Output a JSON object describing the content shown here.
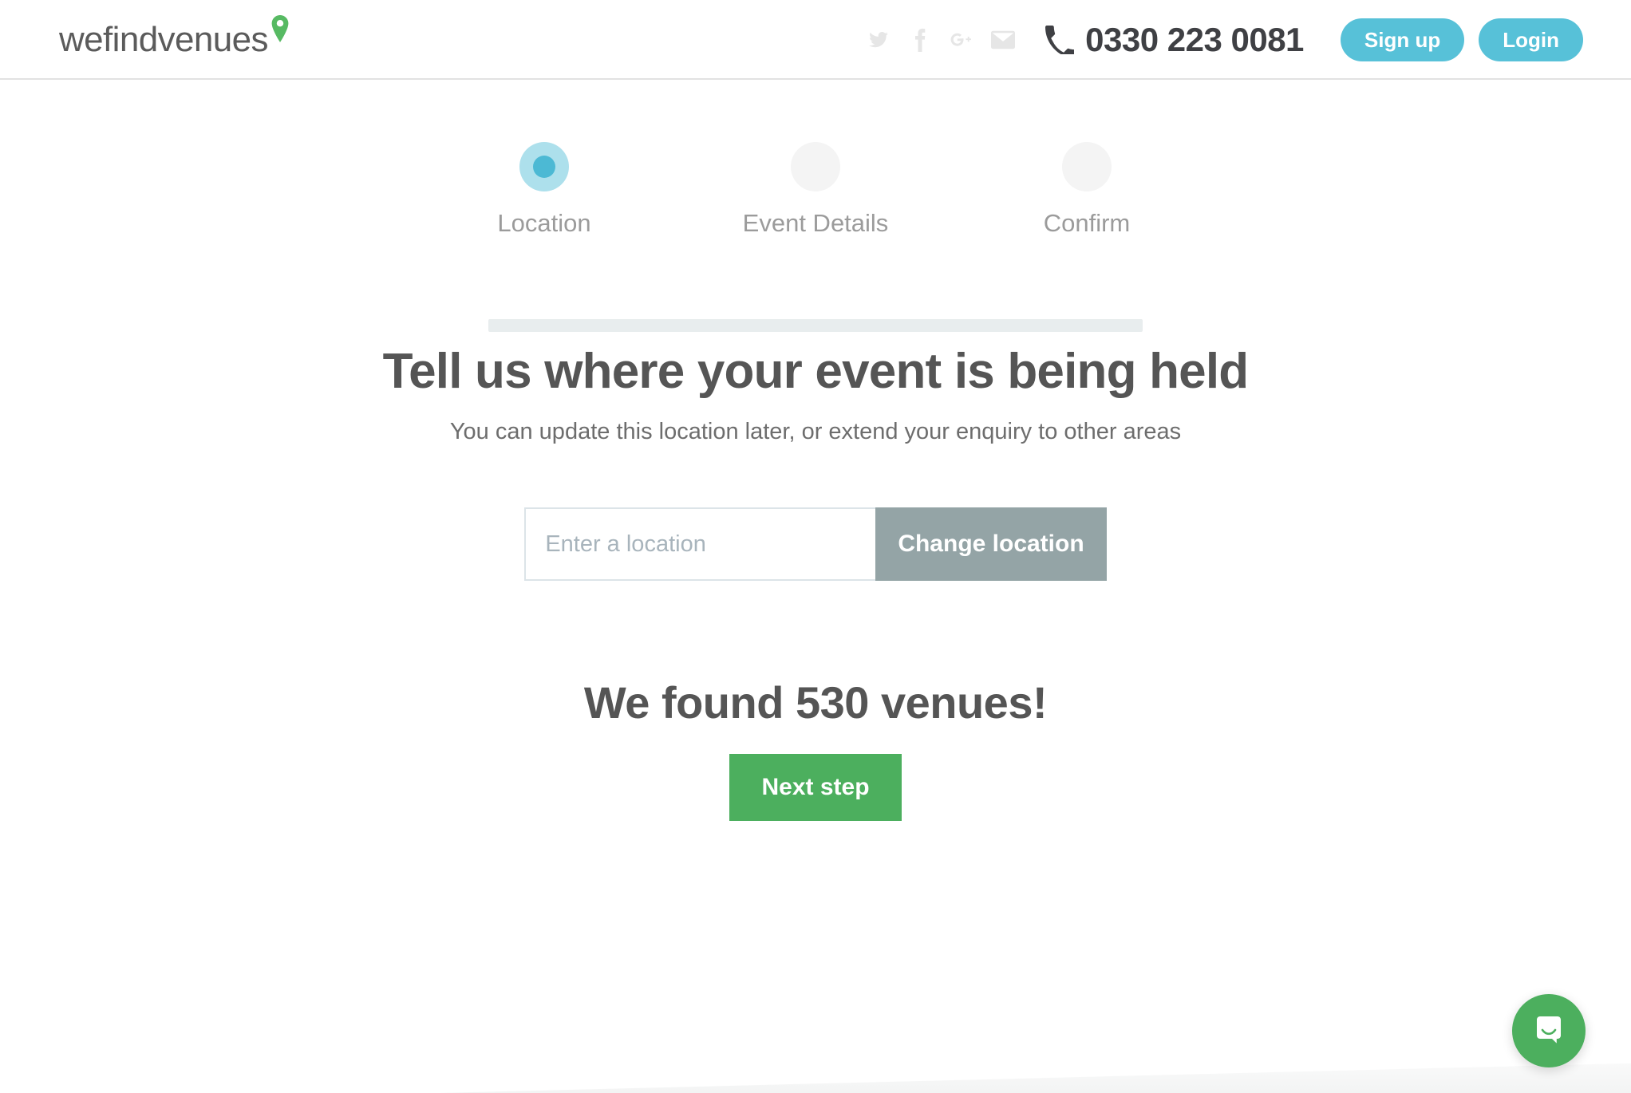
{
  "header": {
    "logo": {
      "text": "wefindvenues",
      "pin_icon": "map-pin-icon",
      "pin_color": "#57ba63"
    },
    "social": [
      {
        "name": "twitter-icon",
        "label": "Twitter"
      },
      {
        "name": "facebook-icon",
        "label": "Facebook"
      },
      {
        "name": "google-plus-icon",
        "label": "Google Plus"
      },
      {
        "name": "email-icon",
        "label": "Email"
      }
    ],
    "phone": {
      "icon": "phone-icon",
      "number": "0330 223 0081"
    },
    "signup_label": "Sign up",
    "login_label": "Login",
    "accent_color": "#57c1d8"
  },
  "stepper": {
    "active_index": 0,
    "steps": [
      {
        "label": "Location"
      },
      {
        "label": "Event Details"
      },
      {
        "label": "Confirm"
      }
    ],
    "active_ring_color": "#ade0ec",
    "active_dot_color": "#4cb9d4",
    "inactive_color": "#f4f4f4",
    "bar_color": "#e8edee"
  },
  "main": {
    "headline": "Tell us where your event is being held",
    "subhead": "You can update this location later, or extend your enquiry to other areas",
    "location_input": {
      "value": "",
      "placeholder": "Enter a location"
    },
    "change_location_label": "Change location",
    "change_location_color": "#94a4a6",
    "result_count_text": "We found 530 venues!",
    "venue_count": 530,
    "next_step_label": "Next step",
    "next_step_color": "#4caf5e"
  },
  "chat": {
    "icon": "chat-bubble-icon",
    "color": "#4caf5e"
  }
}
